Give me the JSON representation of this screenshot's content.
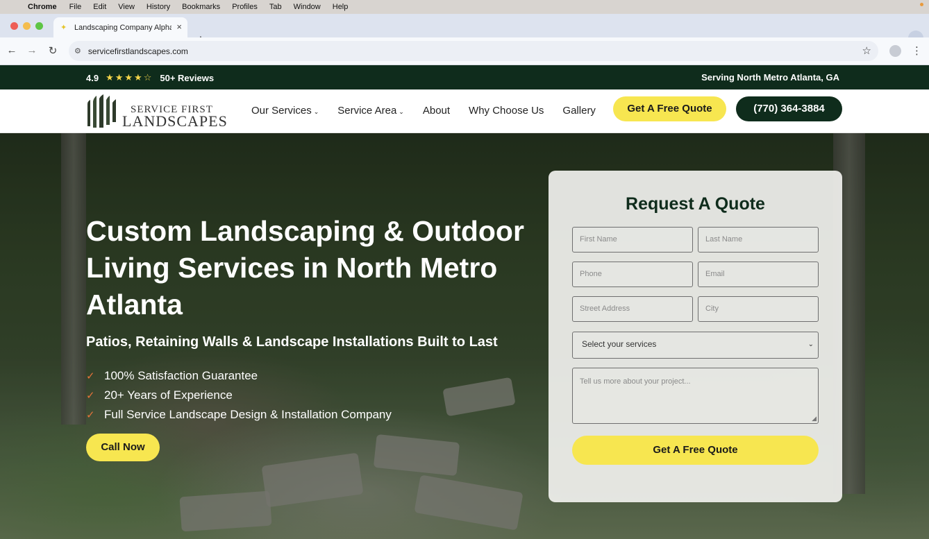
{
  "mac_menubar": {
    "apple_icon": "apple-logo-icon",
    "app_name": "Chrome",
    "items": [
      "File",
      "Edit",
      "View",
      "History",
      "Bookmarks",
      "Profiles",
      "Tab",
      "Window",
      "Help"
    ]
  },
  "browser": {
    "tab_title": "Landscaping Company Alpha",
    "url": "servicefirstlandscapes.com",
    "new_tab_label": "+",
    "close_tab_label": "×"
  },
  "topbar": {
    "rating": "4.9",
    "stars": "★★★★☆",
    "reviews": "50+ Reviews",
    "serving": "Serving North Metro Atlanta, GA"
  },
  "header": {
    "logo_line1": "SERVICE FIRST",
    "logo_line2": "LANDSCAPES",
    "nav": [
      {
        "label": "Our Services",
        "has_dropdown": true
      },
      {
        "label": "Service Area",
        "has_dropdown": true
      },
      {
        "label": "About",
        "has_dropdown": false
      },
      {
        "label": "Why Choose Us",
        "has_dropdown": false
      },
      {
        "label": "Gallery",
        "has_dropdown": false
      }
    ],
    "cta_quote": "Get A Free Quote",
    "cta_phone": "(770) 364-3884"
  },
  "hero": {
    "title": "Custom Landscaping & Outdoor Living Services in North Metro Atlanta",
    "subtitle": "Patios, Retaining Walls & Landscape Installations Built to Last",
    "benefits": [
      "100% Satisfaction Guarantee",
      "20+ Years of Experience",
      "Full Service Landscape Design & Installation Company"
    ],
    "call_button": "Call Now"
  },
  "quote_form": {
    "title": "Request A Quote",
    "first_name_placeholder": "First Name",
    "last_name_placeholder": "Last Name",
    "phone_placeholder": "Phone",
    "email_placeholder": "Email",
    "street_placeholder": "Street Address",
    "city_placeholder": "City",
    "services_select": "Select your services",
    "message_placeholder": "Tell us more about your project...",
    "submit_label": "Get A Free Quote"
  },
  "colors": {
    "brand_dark_green": "#0f2c1c",
    "accent_yellow": "#f7e650",
    "star_yellow": "#f5d54a",
    "check_orange": "#e5723a"
  }
}
